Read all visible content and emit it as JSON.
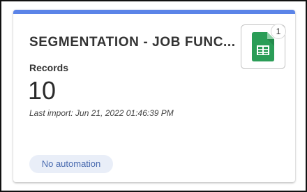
{
  "card": {
    "title": "SEGMENTATION - JOB FUNC...",
    "records_label": "Records",
    "records_value": "10",
    "last_import": "Last import: Jun 21, 2022 01:46:39 PM",
    "automation_badge": "No automation",
    "accent_color": "#5b84e8"
  },
  "source": {
    "icon": "google-sheets-icon",
    "count": "1"
  }
}
